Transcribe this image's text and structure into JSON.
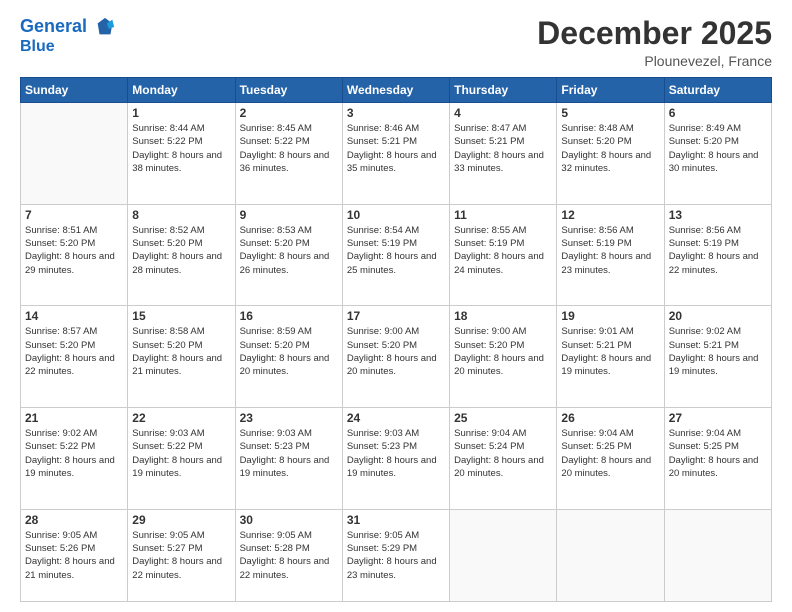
{
  "header": {
    "logo_line1": "General",
    "logo_line2": "Blue",
    "month": "December 2025",
    "location": "Plounevezel, France"
  },
  "weekdays": [
    "Sunday",
    "Monday",
    "Tuesday",
    "Wednesday",
    "Thursday",
    "Friday",
    "Saturday"
  ],
  "weeks": [
    [
      {
        "day": "",
        "empty": true
      },
      {
        "day": "1",
        "sunrise": "8:44 AM",
        "sunset": "5:22 PM",
        "daylight": "8 hours and 38 minutes."
      },
      {
        "day": "2",
        "sunrise": "8:45 AM",
        "sunset": "5:22 PM",
        "daylight": "8 hours and 36 minutes."
      },
      {
        "day": "3",
        "sunrise": "8:46 AM",
        "sunset": "5:21 PM",
        "daylight": "8 hours and 35 minutes."
      },
      {
        "day": "4",
        "sunrise": "8:47 AM",
        "sunset": "5:21 PM",
        "daylight": "8 hours and 33 minutes."
      },
      {
        "day": "5",
        "sunrise": "8:48 AM",
        "sunset": "5:20 PM",
        "daylight": "8 hours and 32 minutes."
      },
      {
        "day": "6",
        "sunrise": "8:49 AM",
        "sunset": "5:20 PM",
        "daylight": "8 hours and 30 minutes."
      }
    ],
    [
      {
        "day": "7",
        "sunrise": "8:51 AM",
        "sunset": "5:20 PM",
        "daylight": "8 hours and 29 minutes."
      },
      {
        "day": "8",
        "sunrise": "8:52 AM",
        "sunset": "5:20 PM",
        "daylight": "8 hours and 28 minutes."
      },
      {
        "day": "9",
        "sunrise": "8:53 AM",
        "sunset": "5:20 PM",
        "daylight": "8 hours and 26 minutes."
      },
      {
        "day": "10",
        "sunrise": "8:54 AM",
        "sunset": "5:19 PM",
        "daylight": "8 hours and 25 minutes."
      },
      {
        "day": "11",
        "sunrise": "8:55 AM",
        "sunset": "5:19 PM",
        "daylight": "8 hours and 24 minutes."
      },
      {
        "day": "12",
        "sunrise": "8:56 AM",
        "sunset": "5:19 PM",
        "daylight": "8 hours and 23 minutes."
      },
      {
        "day": "13",
        "sunrise": "8:56 AM",
        "sunset": "5:19 PM",
        "daylight": "8 hours and 22 minutes."
      }
    ],
    [
      {
        "day": "14",
        "sunrise": "8:57 AM",
        "sunset": "5:20 PM",
        "daylight": "8 hours and 22 minutes."
      },
      {
        "day": "15",
        "sunrise": "8:58 AM",
        "sunset": "5:20 PM",
        "daylight": "8 hours and 21 minutes."
      },
      {
        "day": "16",
        "sunrise": "8:59 AM",
        "sunset": "5:20 PM",
        "daylight": "8 hours and 20 minutes."
      },
      {
        "day": "17",
        "sunrise": "9:00 AM",
        "sunset": "5:20 PM",
        "daylight": "8 hours and 20 minutes."
      },
      {
        "day": "18",
        "sunrise": "9:00 AM",
        "sunset": "5:20 PM",
        "daylight": "8 hours and 20 minutes."
      },
      {
        "day": "19",
        "sunrise": "9:01 AM",
        "sunset": "5:21 PM",
        "daylight": "8 hours and 19 minutes."
      },
      {
        "day": "20",
        "sunrise": "9:02 AM",
        "sunset": "5:21 PM",
        "daylight": "8 hours and 19 minutes."
      }
    ],
    [
      {
        "day": "21",
        "sunrise": "9:02 AM",
        "sunset": "5:22 PM",
        "daylight": "8 hours and 19 minutes."
      },
      {
        "day": "22",
        "sunrise": "9:03 AM",
        "sunset": "5:22 PM",
        "daylight": "8 hours and 19 minutes."
      },
      {
        "day": "23",
        "sunrise": "9:03 AM",
        "sunset": "5:23 PM",
        "daylight": "8 hours and 19 minutes."
      },
      {
        "day": "24",
        "sunrise": "9:03 AM",
        "sunset": "5:23 PM",
        "daylight": "8 hours and 19 minutes."
      },
      {
        "day": "25",
        "sunrise": "9:04 AM",
        "sunset": "5:24 PM",
        "daylight": "8 hours and 20 minutes."
      },
      {
        "day": "26",
        "sunrise": "9:04 AM",
        "sunset": "5:25 PM",
        "daylight": "8 hours and 20 minutes."
      },
      {
        "day": "27",
        "sunrise": "9:04 AM",
        "sunset": "5:25 PM",
        "daylight": "8 hours and 20 minutes."
      }
    ],
    [
      {
        "day": "28",
        "sunrise": "9:05 AM",
        "sunset": "5:26 PM",
        "daylight": "8 hours and 21 minutes."
      },
      {
        "day": "29",
        "sunrise": "9:05 AM",
        "sunset": "5:27 PM",
        "daylight": "8 hours and 22 minutes."
      },
      {
        "day": "30",
        "sunrise": "9:05 AM",
        "sunset": "5:28 PM",
        "daylight": "8 hours and 22 minutes."
      },
      {
        "day": "31",
        "sunrise": "9:05 AM",
        "sunset": "5:29 PM",
        "daylight": "8 hours and 23 minutes."
      },
      {
        "day": "",
        "empty": true
      },
      {
        "day": "",
        "empty": true
      },
      {
        "day": "",
        "empty": true
      }
    ]
  ]
}
